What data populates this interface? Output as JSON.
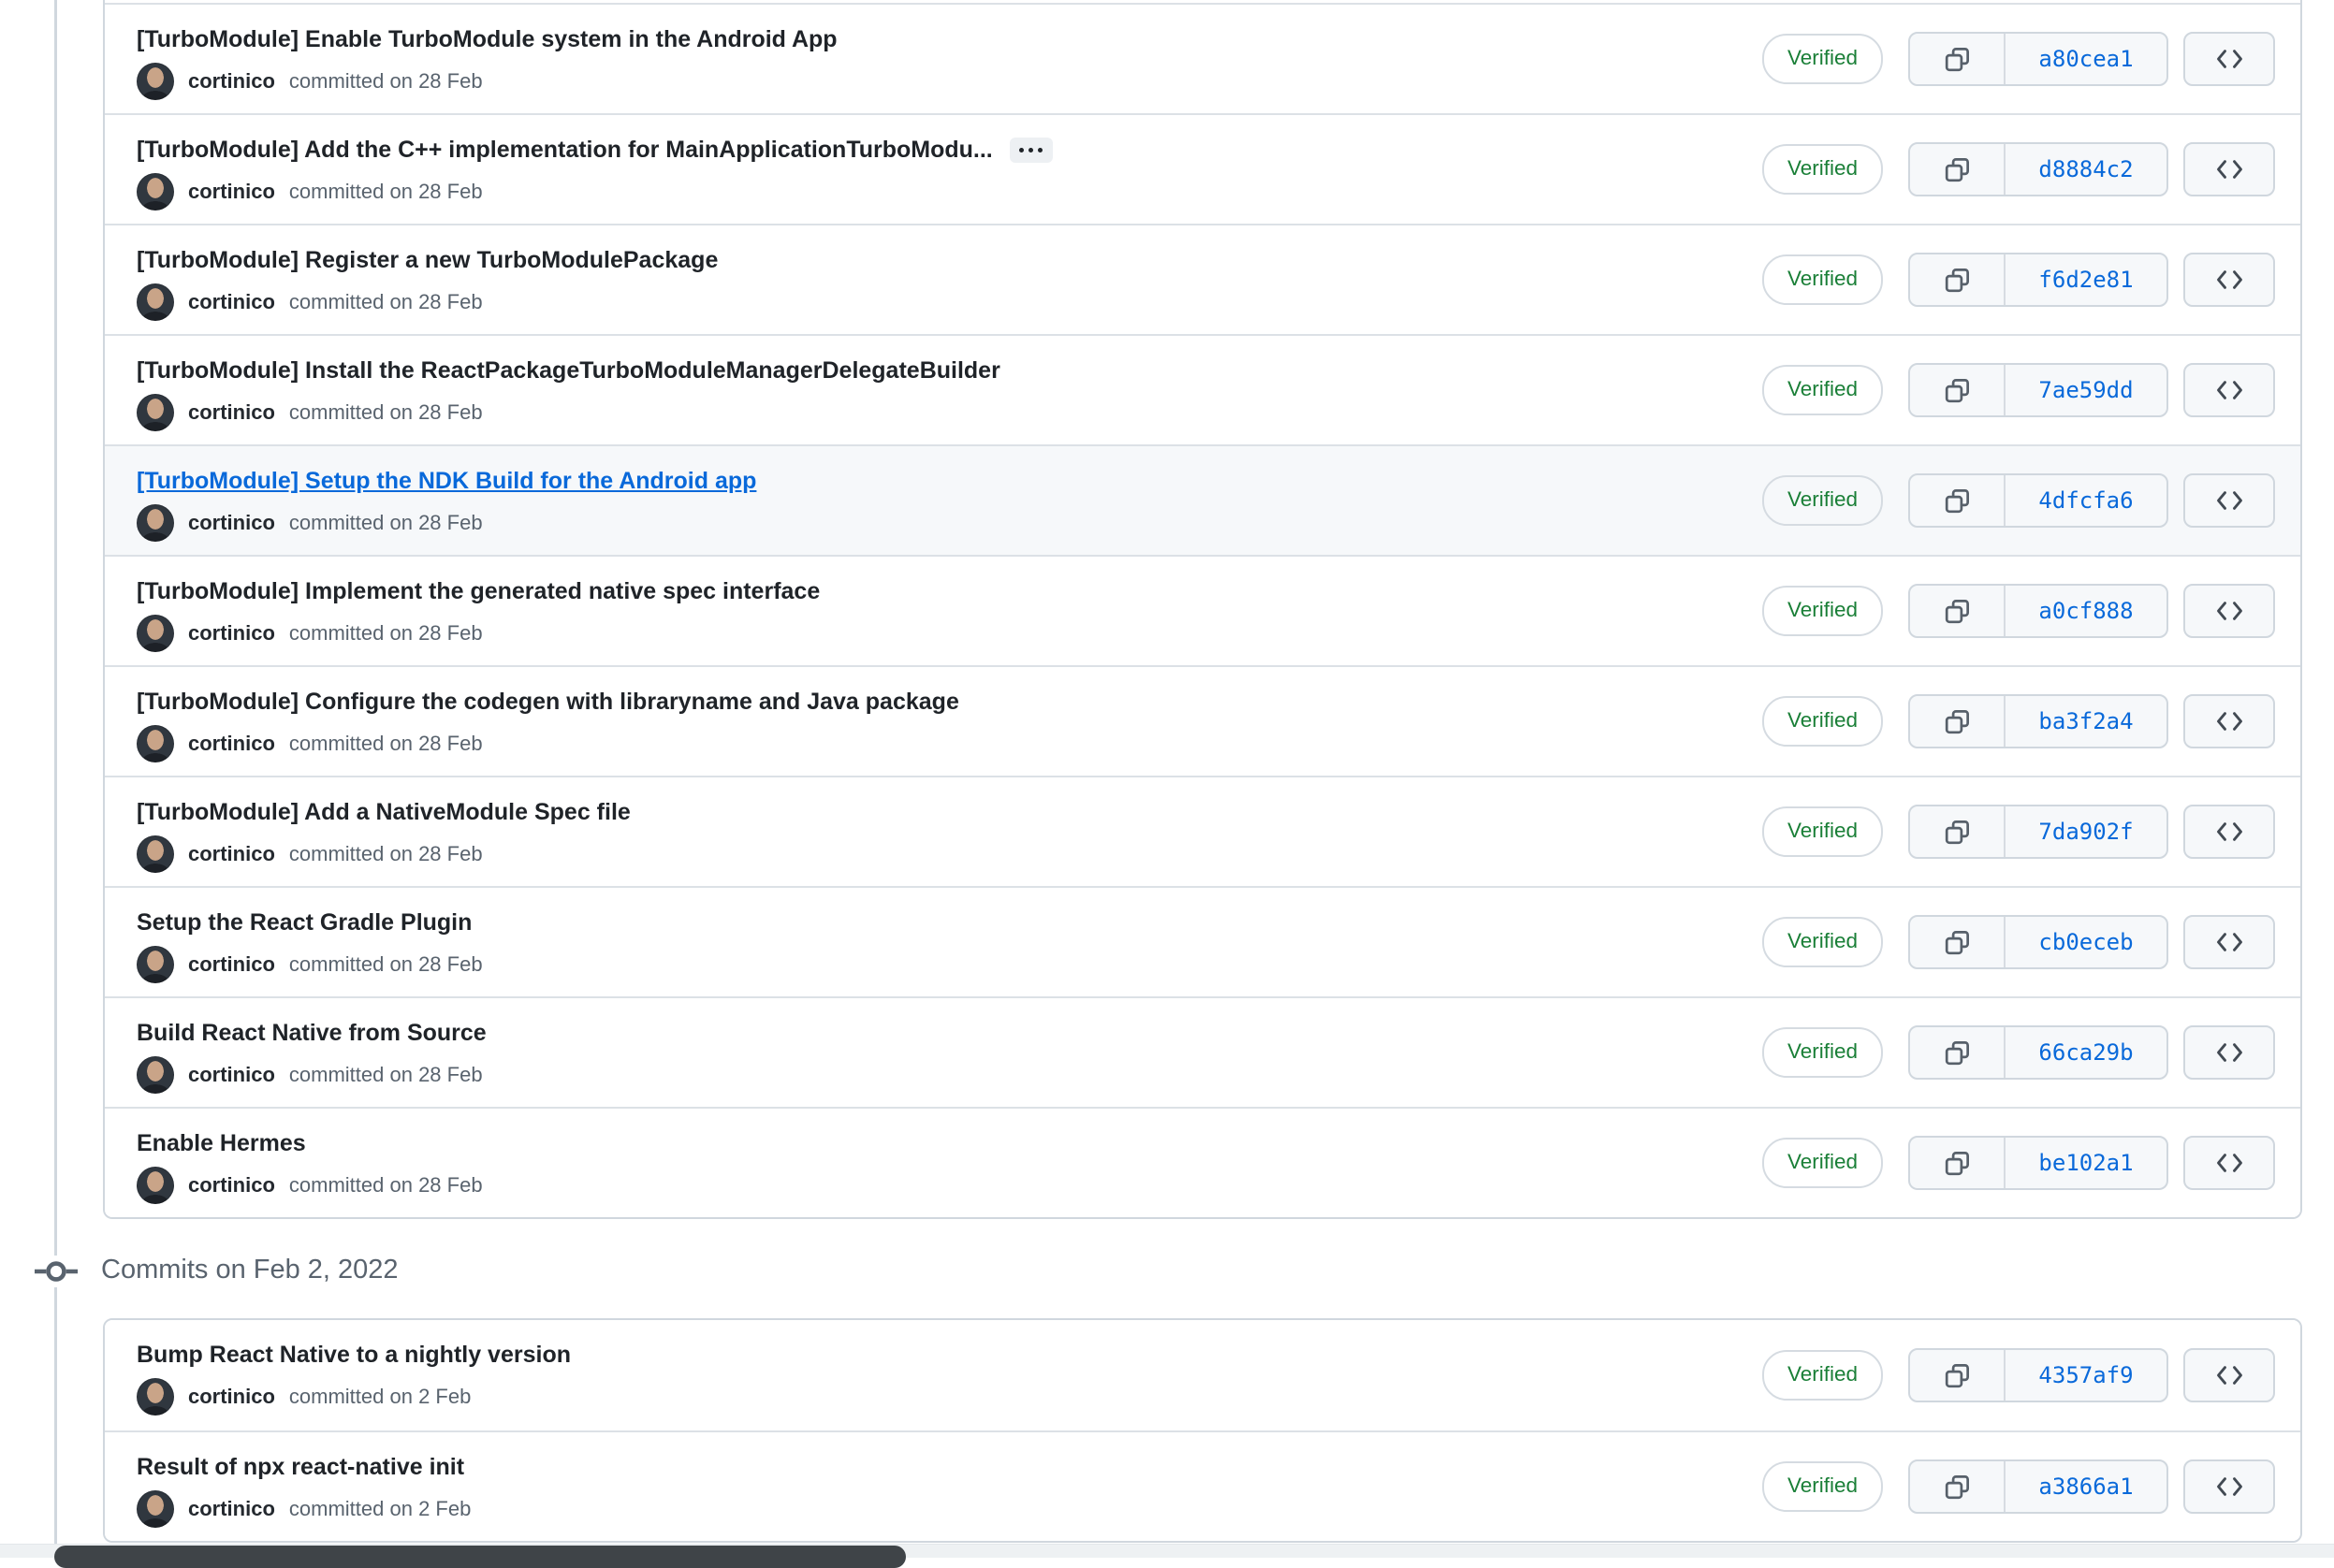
{
  "colors": {
    "link_blue": "#0969da",
    "verified_green": "#1a7f37",
    "card_border": "#d0d7de",
    "row_divider": "#dce1e6",
    "muted_text": "#59636e",
    "title_text": "#1f2328",
    "highlight_row_bg": "#f6f8fa",
    "button_bg": "#f6f8fa",
    "scroll_thumb": "#3f4448",
    "scroll_track": "#eef1f3"
  },
  "icons": {
    "copy": "copy-icon",
    "code": "code-icon",
    "git_commit": "git-commit-icon",
    "ellipsis": "ellipsis-icon"
  },
  "groups": [
    {
      "header": null,
      "commits": [
        {
          "title": "[TurboModule] Enable TurboModule system in the Android App",
          "sha": "a80cea1",
          "author": "cortinico",
          "committed": "committed on 28 Feb",
          "verified": "Verified"
        },
        {
          "title": "[TurboModule] Add the C++ implementation for MainApplicationTurboModu...",
          "sha": "d8884c2",
          "author": "cortinico",
          "committed": "committed on 28 Feb",
          "verified": "Verified",
          "expander": true
        },
        {
          "title": "[TurboModule] Register a new TurboModulePackage",
          "sha": "f6d2e81",
          "author": "cortinico",
          "committed": "committed on 28 Feb",
          "verified": "Verified"
        },
        {
          "title": "[TurboModule] Install the ReactPackageTurboModuleManagerDelegateBuilder",
          "sha": "7ae59dd",
          "author": "cortinico",
          "committed": "committed on 28 Feb",
          "verified": "Verified"
        },
        {
          "title": "[TurboModule] Setup the NDK Build for the Android app",
          "sha": "4dfcfa6",
          "author": "cortinico",
          "committed": "committed on 28 Feb",
          "verified": "Verified",
          "highlighted": true
        },
        {
          "title": "[TurboModule] Implement the generated native spec interface",
          "sha": "a0cf888",
          "author": "cortinico",
          "committed": "committed on 28 Feb",
          "verified": "Verified"
        },
        {
          "title": "[TurboModule] Configure the codegen with libraryname and Java package",
          "sha": "ba3f2a4",
          "author": "cortinico",
          "committed": "committed on 28 Feb",
          "verified": "Verified"
        },
        {
          "title": "[TurboModule] Add a NativeModule Spec file",
          "sha": "7da902f",
          "author": "cortinico",
          "committed": "committed on 28 Feb",
          "verified": "Verified"
        },
        {
          "title": "Setup the React Gradle Plugin",
          "sha": "cb0eceb",
          "author": "cortinico",
          "committed": "committed on 28 Feb",
          "verified": "Verified"
        },
        {
          "title": "Build React Native from Source",
          "sha": "66ca29b",
          "author": "cortinico",
          "committed": "committed on 28 Feb",
          "verified": "Verified"
        },
        {
          "title": "Enable Hermes",
          "sha": "be102a1",
          "author": "cortinico",
          "committed": "committed on 28 Feb",
          "verified": "Verified"
        }
      ]
    },
    {
      "header": "Commits on Feb 2, 2022",
      "commits": [
        {
          "title": "Bump React Native to a nightly version",
          "sha": "4357af9",
          "author": "cortinico",
          "committed": "committed on 2 Feb",
          "verified": "Verified"
        },
        {
          "title": "Result of npx react-native init",
          "sha": "a3866a1",
          "author": "cortinico",
          "committed": "committed on 2 Feb",
          "verified": "Verified"
        }
      ]
    }
  ]
}
